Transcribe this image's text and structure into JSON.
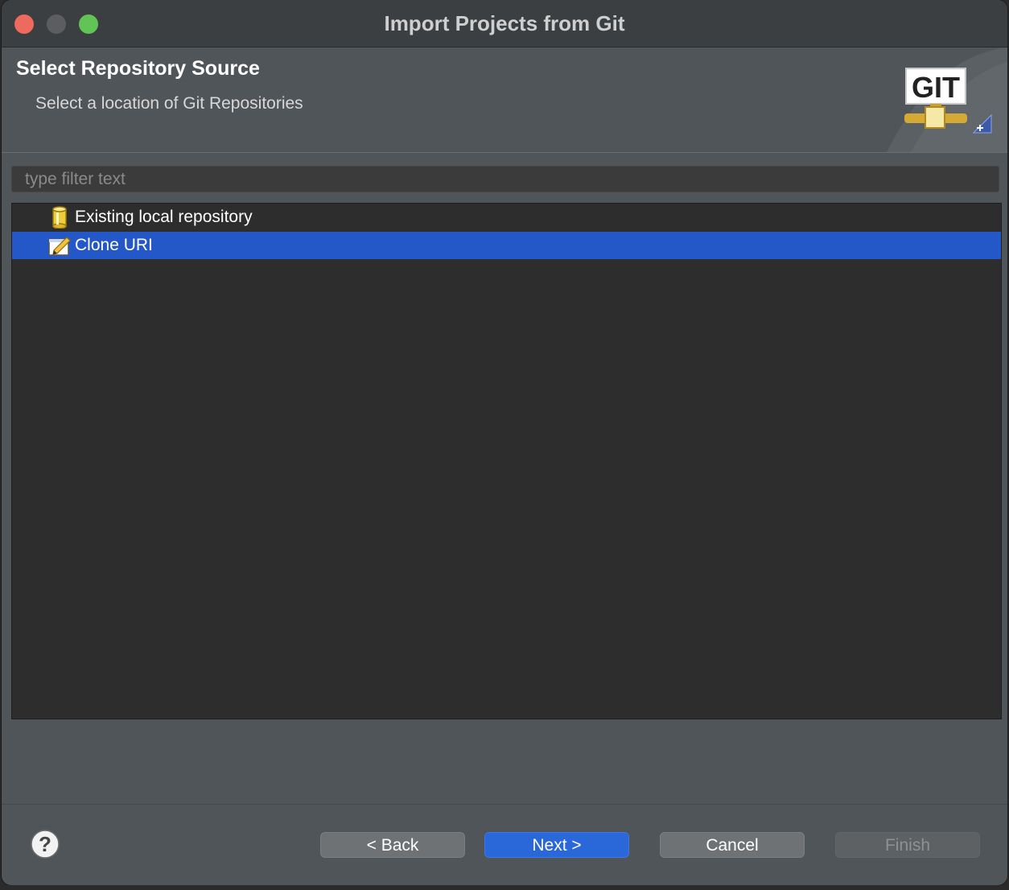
{
  "window": {
    "title": "Import Projects from Git"
  },
  "banner": {
    "heading": "Select Repository Source",
    "description": "Select a location of Git Repositories",
    "logo_text": "GIT"
  },
  "filter": {
    "placeholder": "type filter text",
    "value": ""
  },
  "sources": [
    {
      "label": "Existing local repository",
      "icon": "repository-cylinder-icon",
      "selected": false
    },
    {
      "label": "Clone URI",
      "icon": "clone-uri-icon",
      "selected": true
    }
  ],
  "buttons": {
    "back": "< Back",
    "next": "Next >",
    "cancel": "Cancel",
    "finish": "Finish"
  },
  "colors": {
    "selection": "#2457c8",
    "primary_button": "#2a67d8",
    "close": "#ed6a5e",
    "maximize": "#61c454"
  }
}
